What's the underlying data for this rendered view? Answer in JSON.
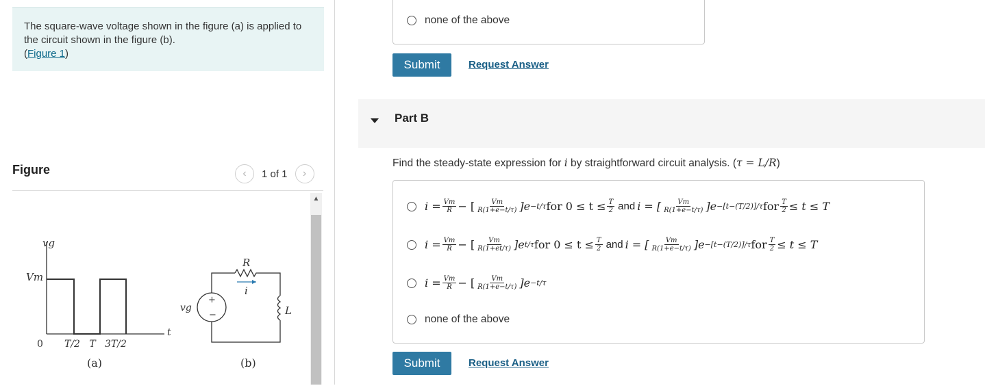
{
  "left": {
    "prompt_text": "The square-wave voltage shown in the figure (a)  is applied to the circuit shown in the figure (b).",
    "figure_link": "Figure 1",
    "figure_title": "Figure",
    "pager_text": "1 of 1",
    "figure_labels": {
      "vg_axis": "vg",
      "vm": "Vm",
      "zero": "0",
      "t_axis": "t",
      "ticks": "T/2   T   3T/2",
      "caption_a": "(a)",
      "caption_b": "(b)",
      "r": "R",
      "i": "i",
      "l": "L",
      "vg_source": "vg",
      "plus": "+",
      "minus": "−"
    }
  },
  "part_a": {
    "last_option": "none of the above",
    "submit_label": "Submit",
    "request_label": "Request Answer"
  },
  "part_b": {
    "label": "Part B",
    "question_prefix": "Find the steady-state expression for ",
    "question_var": "i",
    "question_suffix": " by straightforward circuit analysis. (",
    "question_tau": "τ = L/R",
    "question_close": ")",
    "options": [
      {
        "i_eq": "i = ",
        "vm": "Vm",
        "r": "R",
        "minus_bracket": " − [",
        "den": "R(1+e−t/τ)",
        "after1": "]e",
        "exp1": "−t/τ",
        "for1": " for 0 ≤ t ≤ ",
        "t": "T",
        "two": "2",
        "and": "and",
        "i_eq2": "i = [",
        "den2": "R(1+e−t/τ)",
        "after2": "]e",
        "exp2": "−[t−(T/2)]/τ",
        "for2": " for ",
        "tail": " ≤ t ≤ T"
      },
      {
        "i_eq": "i = ",
        "vm": "Vm",
        "r": "R",
        "minus_bracket": " − [",
        "den": "R(1+et/τ)",
        "after1": "]e",
        "exp1": "t/τ",
        "for1": " for 0 ≤ t ≤ ",
        "t": "T",
        "two": "2",
        "and": "and",
        "i_eq2": "i = [",
        "den2": "R(1+e−t/τ)",
        "after2": "]e",
        "exp2": "−[t−(T/2)]/τ",
        "for2": " for ",
        "tail": " ≤ t ≤ T"
      },
      {
        "i_eq": "i = ",
        "vm": "Vm",
        "r": "R",
        "minus_bracket": " − [",
        "den": "R(1+e−t/τ)",
        "after1": "]e",
        "exp1": "−t/τ"
      }
    ],
    "last_option": "none of the above",
    "submit_label": "Submit",
    "request_label": "Request Answer"
  },
  "colors": {
    "prompt_bg": "#e8f4f4",
    "submit_bg": "#2f7aa3",
    "link": "#1a5f86",
    "partb_bar": "#f5f5f5"
  }
}
